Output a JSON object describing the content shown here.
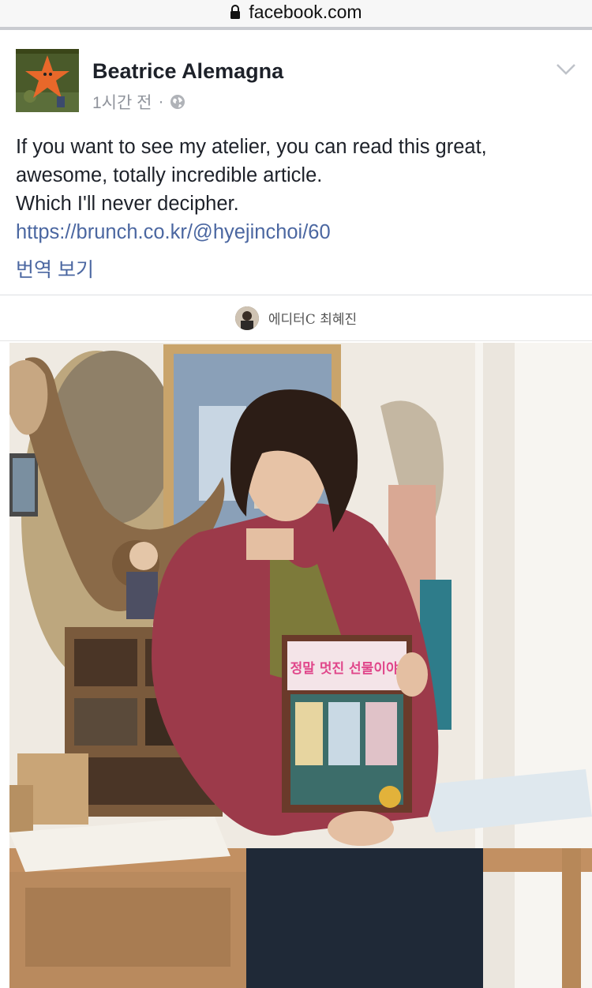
{
  "browser": {
    "url": "facebook.com",
    "lock_icon": "lock-icon"
  },
  "post": {
    "author": "Beatrice Alemagna",
    "timestamp": "1시간 전",
    "separator": "·",
    "privacy_icon": "globe-icon",
    "menu_icon": "chevron-down-icon",
    "text_lines": [
      "If you want to see my atelier, you can read this great,",
      "awesome, totally incredible article.",
      "Which I'll never decipher."
    ],
    "link": "https://brunch.co.kr/@hyejinchoi/60",
    "translate_label": "번역 보기"
  },
  "article_card": {
    "editor_name": "에디터C 최혜진",
    "book_title": "정말 멋진 선물이야!"
  },
  "colors": {
    "link": "#4b67a1",
    "text": "#1d2129",
    "meta": "#90949c"
  }
}
